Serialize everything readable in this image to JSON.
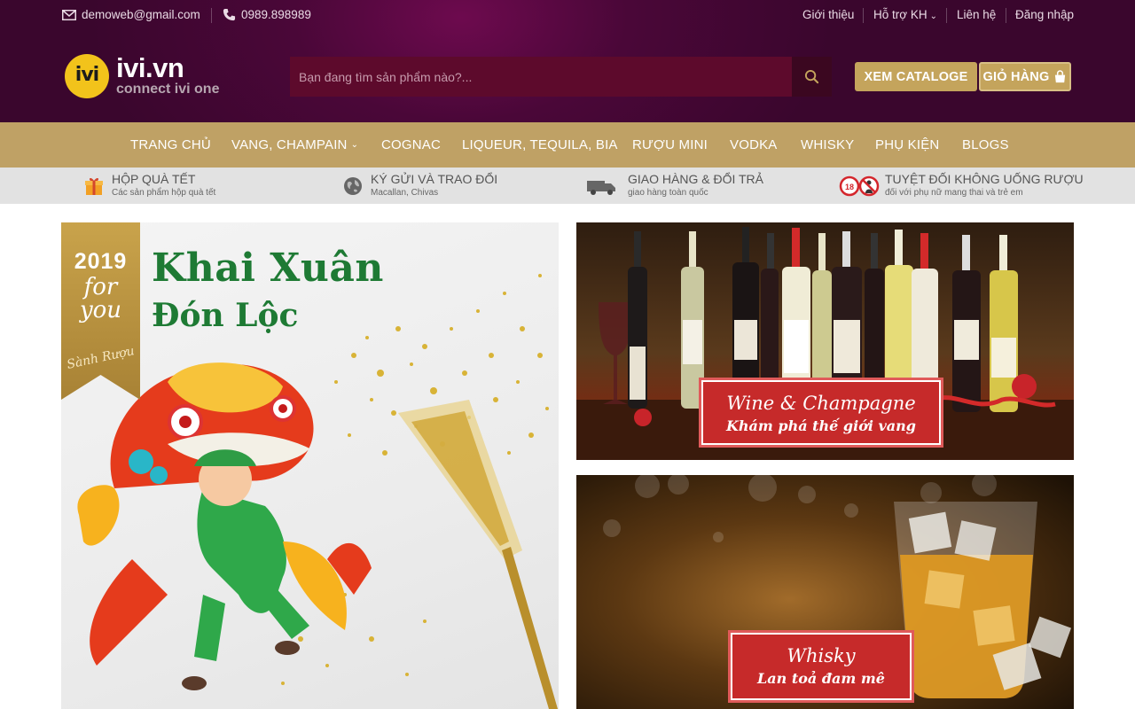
{
  "topbar": {
    "email": "demoweb@gmail.com",
    "phone": "0989.898989",
    "links": [
      "Giới thiệu",
      "Hỗ trợ KH",
      "Liên hệ",
      "Đăng nhập"
    ]
  },
  "logo": {
    "mark": "ivi",
    "brand": "ivi.vn",
    "tagline": "connect ivi one"
  },
  "search": {
    "placeholder": "Bạn đang tìm sản phẩm nào?..."
  },
  "buttons": {
    "catalog": "XEM CATALOGE",
    "cart": "GIỎ HÀNG"
  },
  "nav": {
    "items": [
      "TRANG CHỦ",
      "VANG, CHAMPAIN",
      "COGNAC",
      "LIQUEUR, TEQUILA, BIA",
      "RƯỢU MINI",
      "VODKA",
      "WHISKY",
      "PHỤ KIỆN",
      "BLOGS"
    ]
  },
  "features": [
    {
      "title": "HỘP QUÀ TẾT",
      "subtitle": "Các sản phẩm hộp quà tết",
      "icon": "gift-icon"
    },
    {
      "title": "KÝ GỬI VÀ TRAO ĐỔI",
      "subtitle": "Macallan, Chivas",
      "icon": "globe-icon"
    },
    {
      "title": "GIAO HÀNG & ĐỔI TRẢ",
      "subtitle": "giao hàng toàn quốc",
      "icon": "truck-icon"
    },
    {
      "title": "TUYỆT ĐỐI KHÔNG UỐNG RƯỢU",
      "subtitle": "đối với phụ nữ mang thai và trẻ em",
      "icon": "no-alcohol-icon"
    }
  ],
  "banners": {
    "left": {
      "year": "2019",
      "ribbon_line": "for you",
      "ribbon_sign": "Sành Rượu",
      "headline": "Khai Xuân",
      "subheadline": "Đón Lộc"
    },
    "wine": {
      "title": "Wine & Champagne",
      "subtitle": "Khám phá thế giới vang"
    },
    "whisky": {
      "title": "Whisky",
      "subtitle": "Lan toả đam mê"
    }
  },
  "colors": {
    "header_bg": "#4a0738",
    "gold": "#bfa165",
    "button_gold": "#c4a45c",
    "features_bg": "#e2e2e2",
    "green_text": "#1e7a34",
    "sign_red": "#c62a2a"
  }
}
